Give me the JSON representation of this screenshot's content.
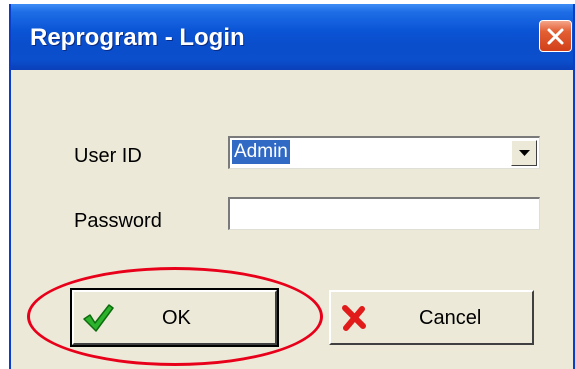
{
  "window": {
    "title": "Reprogram - Login"
  },
  "form": {
    "user_id_label": "User ID",
    "user_id_value": "Admin",
    "password_label": "Password",
    "password_value": ""
  },
  "buttons": {
    "ok_label": "OK",
    "cancel_label": "Cancel"
  },
  "icons": {
    "ok": "checkmark-icon",
    "cancel": "x-icon",
    "close": "close-icon",
    "dropdown": "dropdown-arrow-icon"
  },
  "colors": {
    "titlebar": "#0a55d6",
    "dialog_bg": "#ece9d8",
    "selection": "#316ac5",
    "annotation": "#e8001a"
  }
}
